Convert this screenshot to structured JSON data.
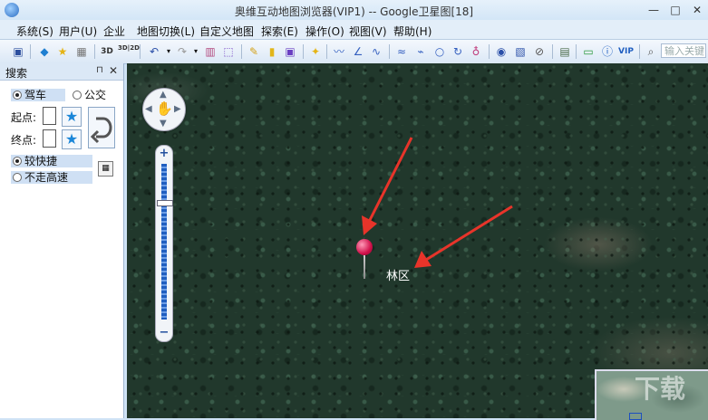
{
  "window": {
    "title": "奥维互动地图浏览器(VIP1) -- Google卫星图[18]",
    "minimize": "—",
    "maximize": "□",
    "close": "✕"
  },
  "menu": [
    "系统(S)",
    "用户(U)",
    "企业",
    "地图切换(L)",
    "自定义地图",
    "探索(E)",
    "操作(O)",
    "视图(V)",
    "帮助(H)"
  ],
  "toolbar": {
    "btn_3d": "3D",
    "btn_3d2d": "3D|2D",
    "btn_vip": "VIP",
    "search_placeholder": "输入关键"
  },
  "search_panel": {
    "title": "搜索",
    "pin": "⊓",
    "close": "✕",
    "modes": [
      {
        "label": "驾车",
        "selected": true
      },
      {
        "label": "公交",
        "selected": false
      }
    ],
    "start_label": "起点:",
    "end_label": "终点:",
    "route_options": [
      {
        "label": "较快捷",
        "selected": true
      },
      {
        "label": "不走高速",
        "selected": false
      }
    ]
  },
  "map": {
    "place_label": "林区",
    "watermark": "下载"
  },
  "colors": {
    "pin": "#d0104a",
    "arrow": "#e8342a",
    "accent": "#1a86d8"
  }
}
